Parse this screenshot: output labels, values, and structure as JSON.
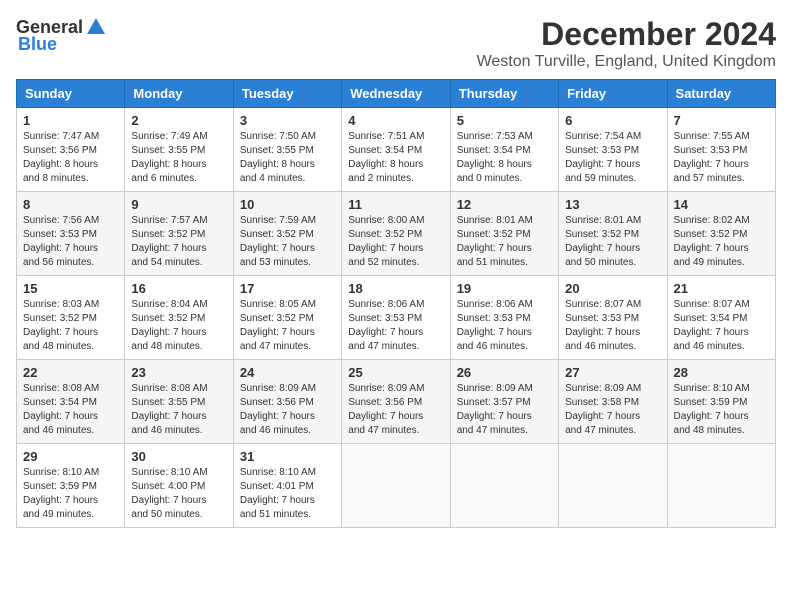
{
  "header": {
    "logo_general": "General",
    "logo_blue": "Blue",
    "title": "December 2024",
    "location": "Weston Turville, England, United Kingdom"
  },
  "weekdays": [
    "Sunday",
    "Monday",
    "Tuesday",
    "Wednesday",
    "Thursday",
    "Friday",
    "Saturday"
  ],
  "weeks": [
    [
      {
        "day": "1",
        "info": "Sunrise: 7:47 AM\nSunset: 3:56 PM\nDaylight: 8 hours\nand 8 minutes."
      },
      {
        "day": "2",
        "info": "Sunrise: 7:49 AM\nSunset: 3:55 PM\nDaylight: 8 hours\nand 6 minutes."
      },
      {
        "day": "3",
        "info": "Sunrise: 7:50 AM\nSunset: 3:55 PM\nDaylight: 8 hours\nand 4 minutes."
      },
      {
        "day": "4",
        "info": "Sunrise: 7:51 AM\nSunset: 3:54 PM\nDaylight: 8 hours\nand 2 minutes."
      },
      {
        "day": "5",
        "info": "Sunrise: 7:53 AM\nSunset: 3:54 PM\nDaylight: 8 hours\nand 0 minutes."
      },
      {
        "day": "6",
        "info": "Sunrise: 7:54 AM\nSunset: 3:53 PM\nDaylight: 7 hours\nand 59 minutes."
      },
      {
        "day": "7",
        "info": "Sunrise: 7:55 AM\nSunset: 3:53 PM\nDaylight: 7 hours\nand 57 minutes."
      }
    ],
    [
      {
        "day": "8",
        "info": "Sunrise: 7:56 AM\nSunset: 3:53 PM\nDaylight: 7 hours\nand 56 minutes."
      },
      {
        "day": "9",
        "info": "Sunrise: 7:57 AM\nSunset: 3:52 PM\nDaylight: 7 hours\nand 54 minutes."
      },
      {
        "day": "10",
        "info": "Sunrise: 7:59 AM\nSunset: 3:52 PM\nDaylight: 7 hours\nand 53 minutes."
      },
      {
        "day": "11",
        "info": "Sunrise: 8:00 AM\nSunset: 3:52 PM\nDaylight: 7 hours\nand 52 minutes."
      },
      {
        "day": "12",
        "info": "Sunrise: 8:01 AM\nSunset: 3:52 PM\nDaylight: 7 hours\nand 51 minutes."
      },
      {
        "day": "13",
        "info": "Sunrise: 8:01 AM\nSunset: 3:52 PM\nDaylight: 7 hours\nand 50 minutes."
      },
      {
        "day": "14",
        "info": "Sunrise: 8:02 AM\nSunset: 3:52 PM\nDaylight: 7 hours\nand 49 minutes."
      }
    ],
    [
      {
        "day": "15",
        "info": "Sunrise: 8:03 AM\nSunset: 3:52 PM\nDaylight: 7 hours\nand 48 minutes."
      },
      {
        "day": "16",
        "info": "Sunrise: 8:04 AM\nSunset: 3:52 PM\nDaylight: 7 hours\nand 48 minutes."
      },
      {
        "day": "17",
        "info": "Sunrise: 8:05 AM\nSunset: 3:52 PM\nDaylight: 7 hours\nand 47 minutes."
      },
      {
        "day": "18",
        "info": "Sunrise: 8:06 AM\nSunset: 3:53 PM\nDaylight: 7 hours\nand 47 minutes."
      },
      {
        "day": "19",
        "info": "Sunrise: 8:06 AM\nSunset: 3:53 PM\nDaylight: 7 hours\nand 46 minutes."
      },
      {
        "day": "20",
        "info": "Sunrise: 8:07 AM\nSunset: 3:53 PM\nDaylight: 7 hours\nand 46 minutes."
      },
      {
        "day": "21",
        "info": "Sunrise: 8:07 AM\nSunset: 3:54 PM\nDaylight: 7 hours\nand 46 minutes."
      }
    ],
    [
      {
        "day": "22",
        "info": "Sunrise: 8:08 AM\nSunset: 3:54 PM\nDaylight: 7 hours\nand 46 minutes."
      },
      {
        "day": "23",
        "info": "Sunrise: 8:08 AM\nSunset: 3:55 PM\nDaylight: 7 hours\nand 46 minutes."
      },
      {
        "day": "24",
        "info": "Sunrise: 8:09 AM\nSunset: 3:56 PM\nDaylight: 7 hours\nand 46 minutes."
      },
      {
        "day": "25",
        "info": "Sunrise: 8:09 AM\nSunset: 3:56 PM\nDaylight: 7 hours\nand 47 minutes."
      },
      {
        "day": "26",
        "info": "Sunrise: 8:09 AM\nSunset: 3:57 PM\nDaylight: 7 hours\nand 47 minutes."
      },
      {
        "day": "27",
        "info": "Sunrise: 8:09 AM\nSunset: 3:58 PM\nDaylight: 7 hours\nand 47 minutes."
      },
      {
        "day": "28",
        "info": "Sunrise: 8:10 AM\nSunset: 3:59 PM\nDaylight: 7 hours\nand 48 minutes."
      }
    ],
    [
      {
        "day": "29",
        "info": "Sunrise: 8:10 AM\nSunset: 3:59 PM\nDaylight: 7 hours\nand 49 minutes."
      },
      {
        "day": "30",
        "info": "Sunrise: 8:10 AM\nSunset: 4:00 PM\nDaylight: 7 hours\nand 50 minutes."
      },
      {
        "day": "31",
        "info": "Sunrise: 8:10 AM\nSunset: 4:01 PM\nDaylight: 7 hours\nand 51 minutes."
      },
      null,
      null,
      null,
      null
    ]
  ]
}
